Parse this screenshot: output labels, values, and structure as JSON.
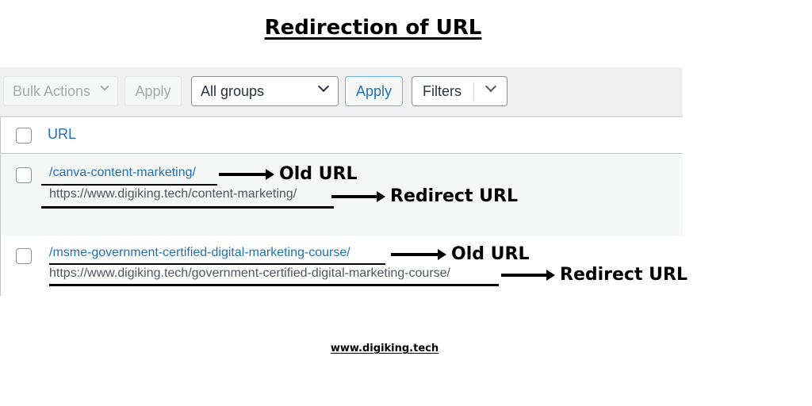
{
  "title": "Redirection of URL",
  "toolbar": {
    "bulk_actions": "Bulk Actions",
    "apply_1": "Apply",
    "groups_selected": "All groups",
    "apply_2": "Apply",
    "filters": "Filters"
  },
  "table": {
    "header": "URL",
    "rows": [
      {
        "old_url": "/canva-content-marketing/",
        "redirect_url": "https://www.digiking.tech/content-marketing/",
        "old_label": "Old URL",
        "redirect_label": "Redirect URL"
      },
      {
        "old_url": "/msme-government-certified-digital-marketing-course/",
        "redirect_url": "https://www.digiking.tech/government-certified-digital-marketing-course/",
        "old_label": "Old URL",
        "redirect_label": "Redirect URL"
      }
    ]
  },
  "footer": "www.digiking.tech",
  "colors": {
    "link": "#2271b1",
    "toolbar_bg": "#f0f0f1",
    "row_alt_bg": "#f6f7f7",
    "primary_border": "#72aee6"
  }
}
